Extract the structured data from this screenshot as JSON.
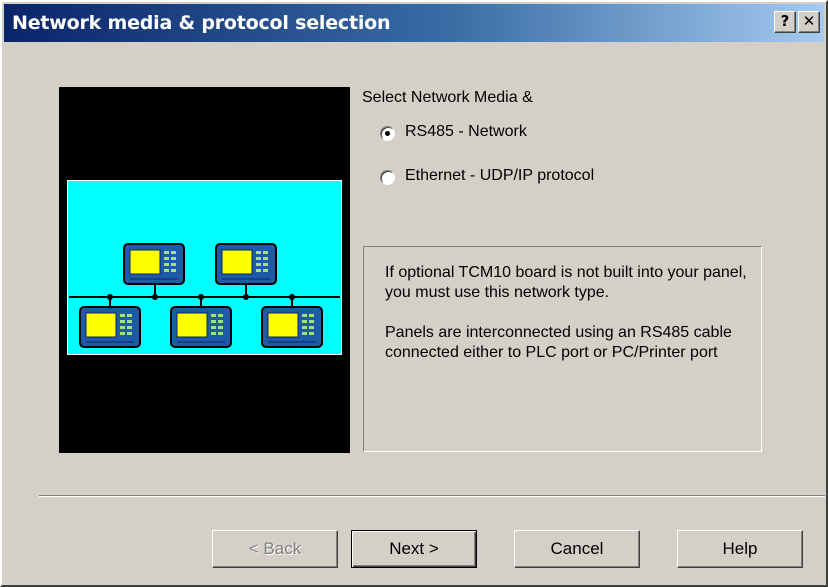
{
  "window": {
    "title": "Network media & protocol selection",
    "help_glyph": "?",
    "close_glyph": "✕"
  },
  "image": {
    "description_icon": "rs485-network-diagram"
  },
  "selection": {
    "heading": "Select Network Media &",
    "options": [
      {
        "label": "RS485 - Network",
        "selected": true
      },
      {
        "label": "Ethernet  - UDP/IP protocol",
        "selected": false
      }
    ]
  },
  "info": {
    "paragraphs": [
      "If optional TCM10 board is not built into your panel, you must use this network type.",
      "Panels are interconnected using an RS485 cable connected either to PLC port or PC/Printer port"
    ]
  },
  "buttons": {
    "back": "< Back",
    "next": "Next >",
    "cancel": "Cancel",
    "help": "Help"
  },
  "colors": {
    "title_gradient_start": "#0a246a",
    "dialog_face": "#d4d0c8",
    "diagram_bg": "#00ffff",
    "panel_body": "#1e5aa8",
    "panel_screen": "#ffff00"
  }
}
